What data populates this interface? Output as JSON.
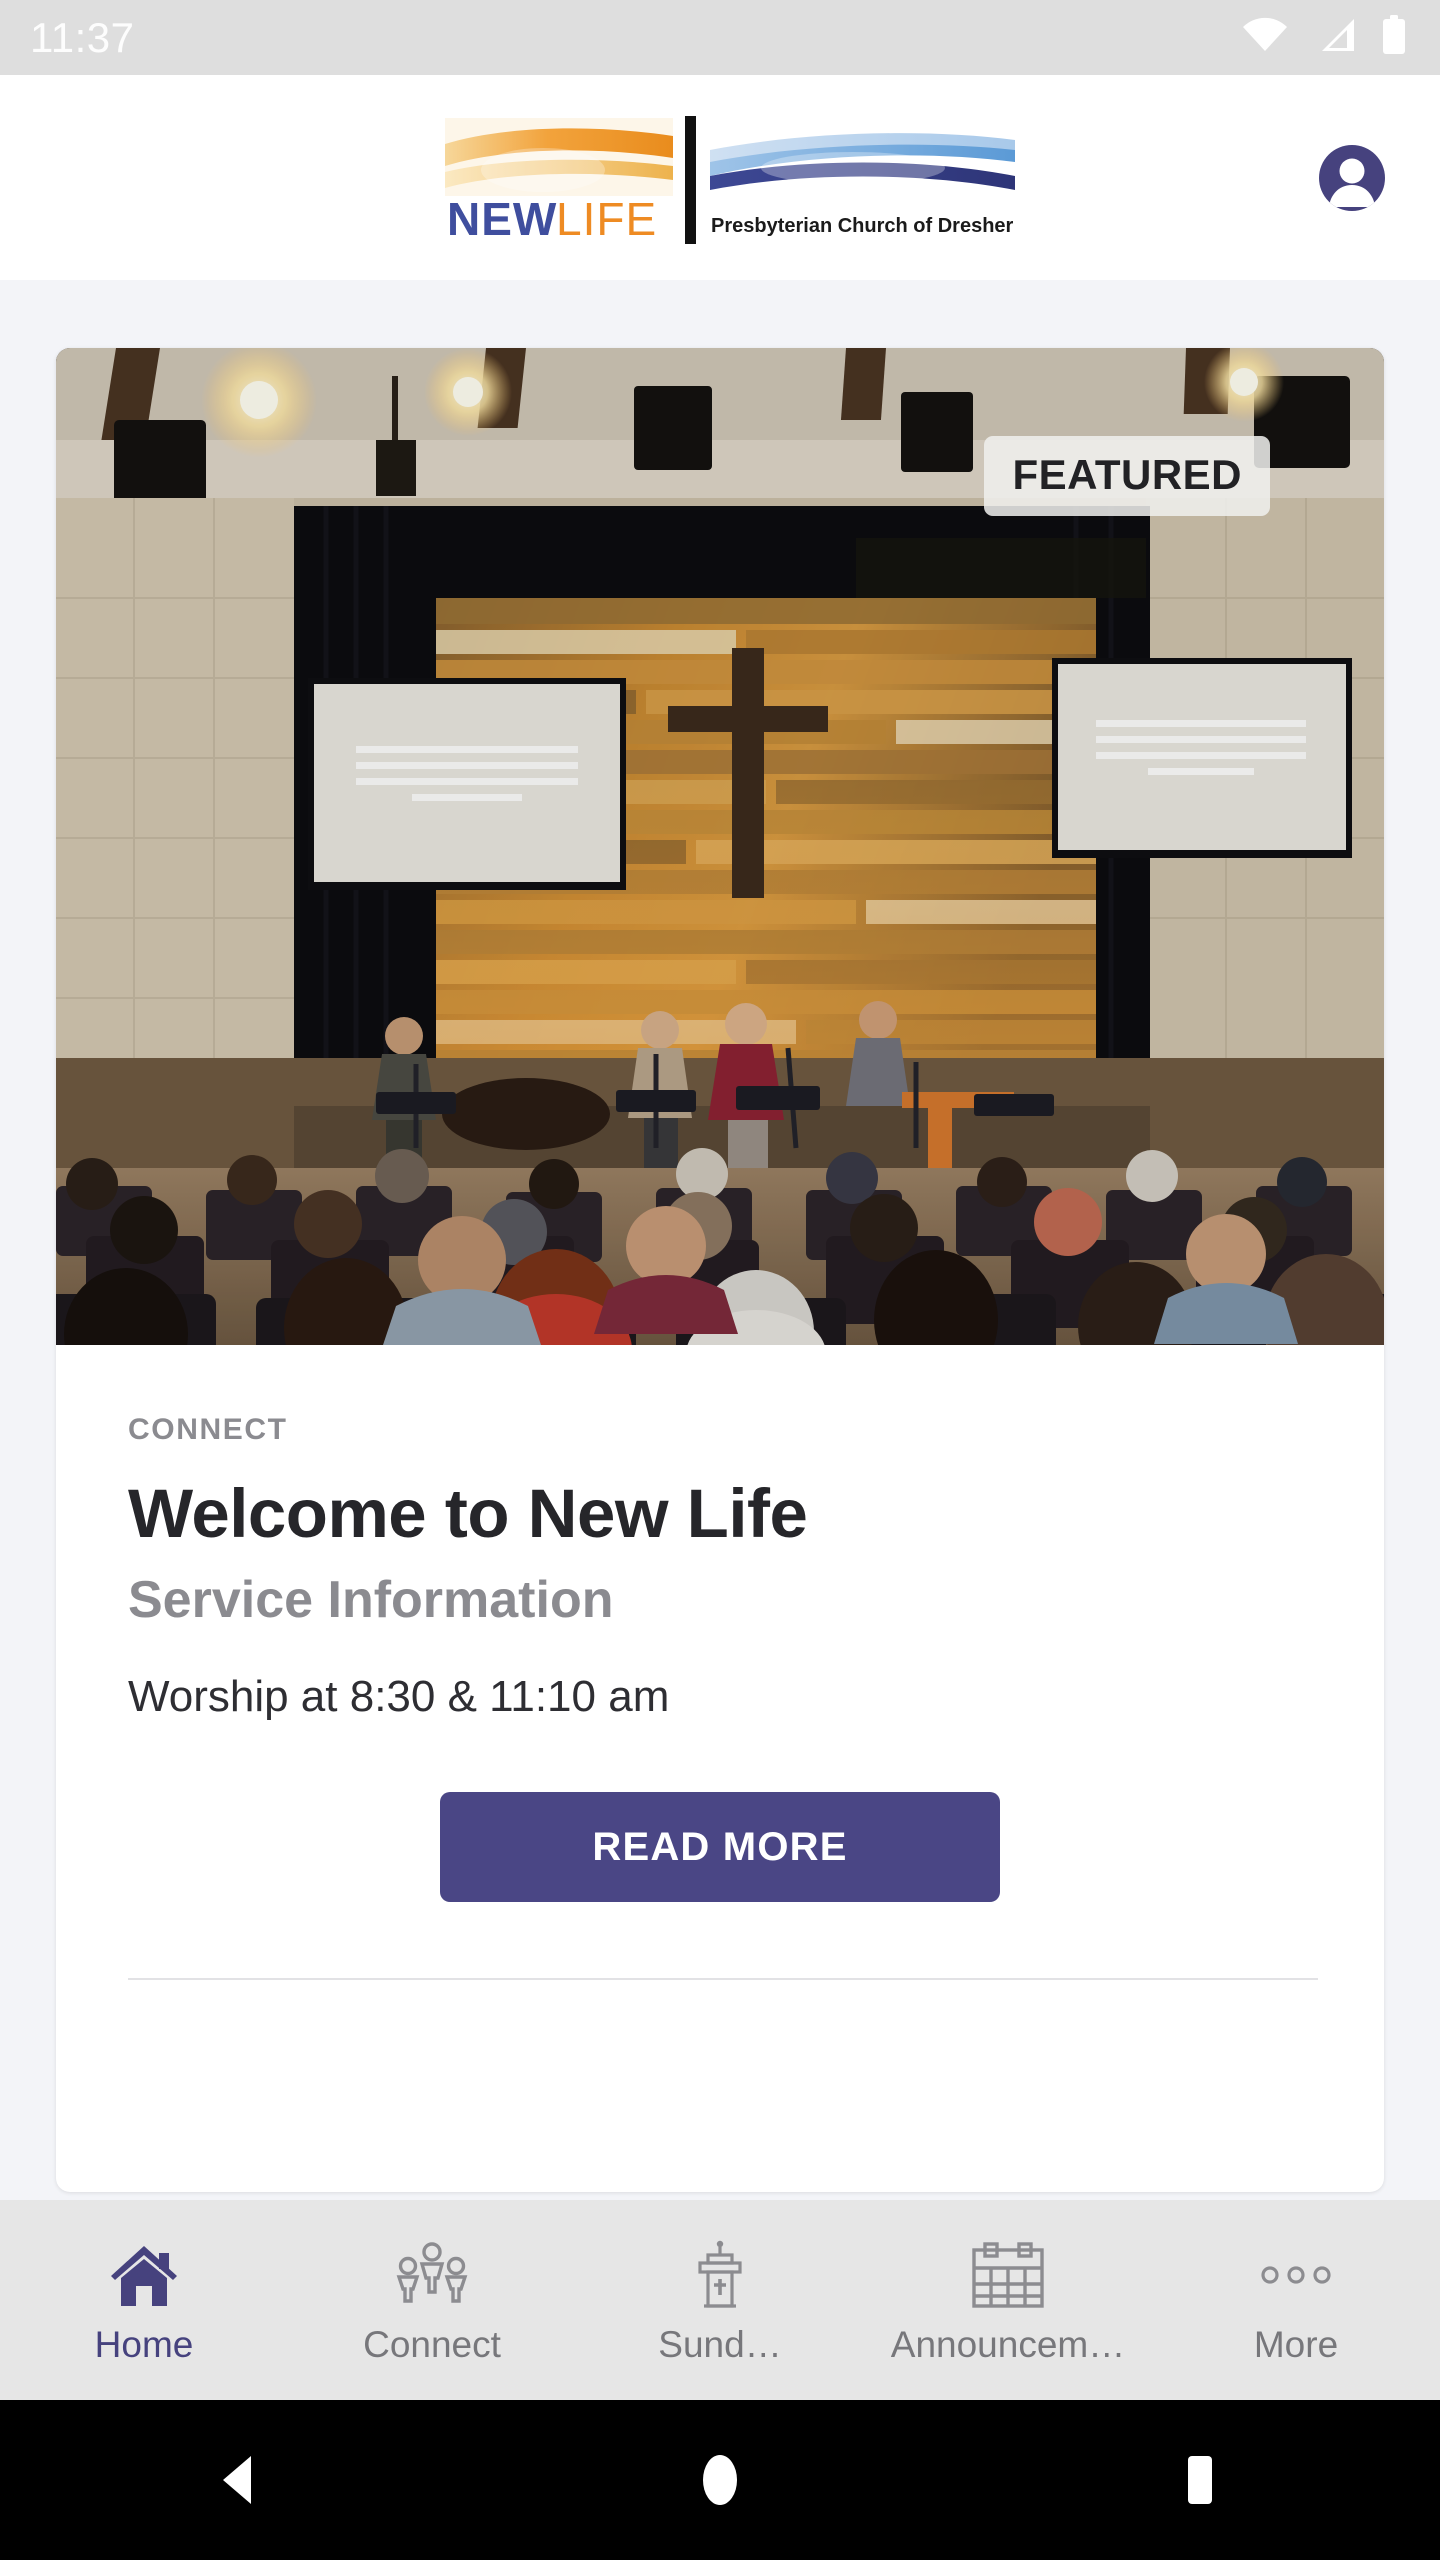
{
  "status_bar": {
    "time": "11:37",
    "icons": [
      "wifi-icon",
      "cellular-signal-icon",
      "battery-icon"
    ]
  },
  "header": {
    "logo": {
      "name_primary": "NEW",
      "name_secondary": "LIFE",
      "tagline": "Presbyterian Church of Dresher"
    },
    "account_icon": "account-avatar-icon"
  },
  "featured_card": {
    "badge": "FEATURED",
    "eyebrow": "CONNECT",
    "title": "Welcome to New Life",
    "subtitle": "Service Information",
    "body": "Worship at 8:30 & 11:10 am",
    "cta_label": "READ MORE",
    "hero_alt": "Church sanctuary with worship band on stage and seated congregation"
  },
  "tab_bar": {
    "items": [
      {
        "label": "Home",
        "icon": "home-icon",
        "active": true
      },
      {
        "label": "Connect",
        "icon": "people-group-icon",
        "active": false
      },
      {
        "label": "Sund…",
        "icon": "pulpit-icon",
        "active": false
      },
      {
        "label": "Announcem…",
        "icon": "calendar-icon",
        "active": false
      },
      {
        "label": "More",
        "icon": "more-dots-icon",
        "active": false
      }
    ]
  },
  "android_nav": {
    "back": "back-triangle-icon",
    "home": "home-circle-icon",
    "recents": "recents-square-icon"
  },
  "colors": {
    "accent_purple": "#4a4685",
    "logo_orange": "#ee8b23",
    "logo_blue": "#3f4e9e",
    "page_bg": "#f3f4f8",
    "tabbar_bg": "#e6e6e6",
    "muted_text": "#8b8b90"
  }
}
